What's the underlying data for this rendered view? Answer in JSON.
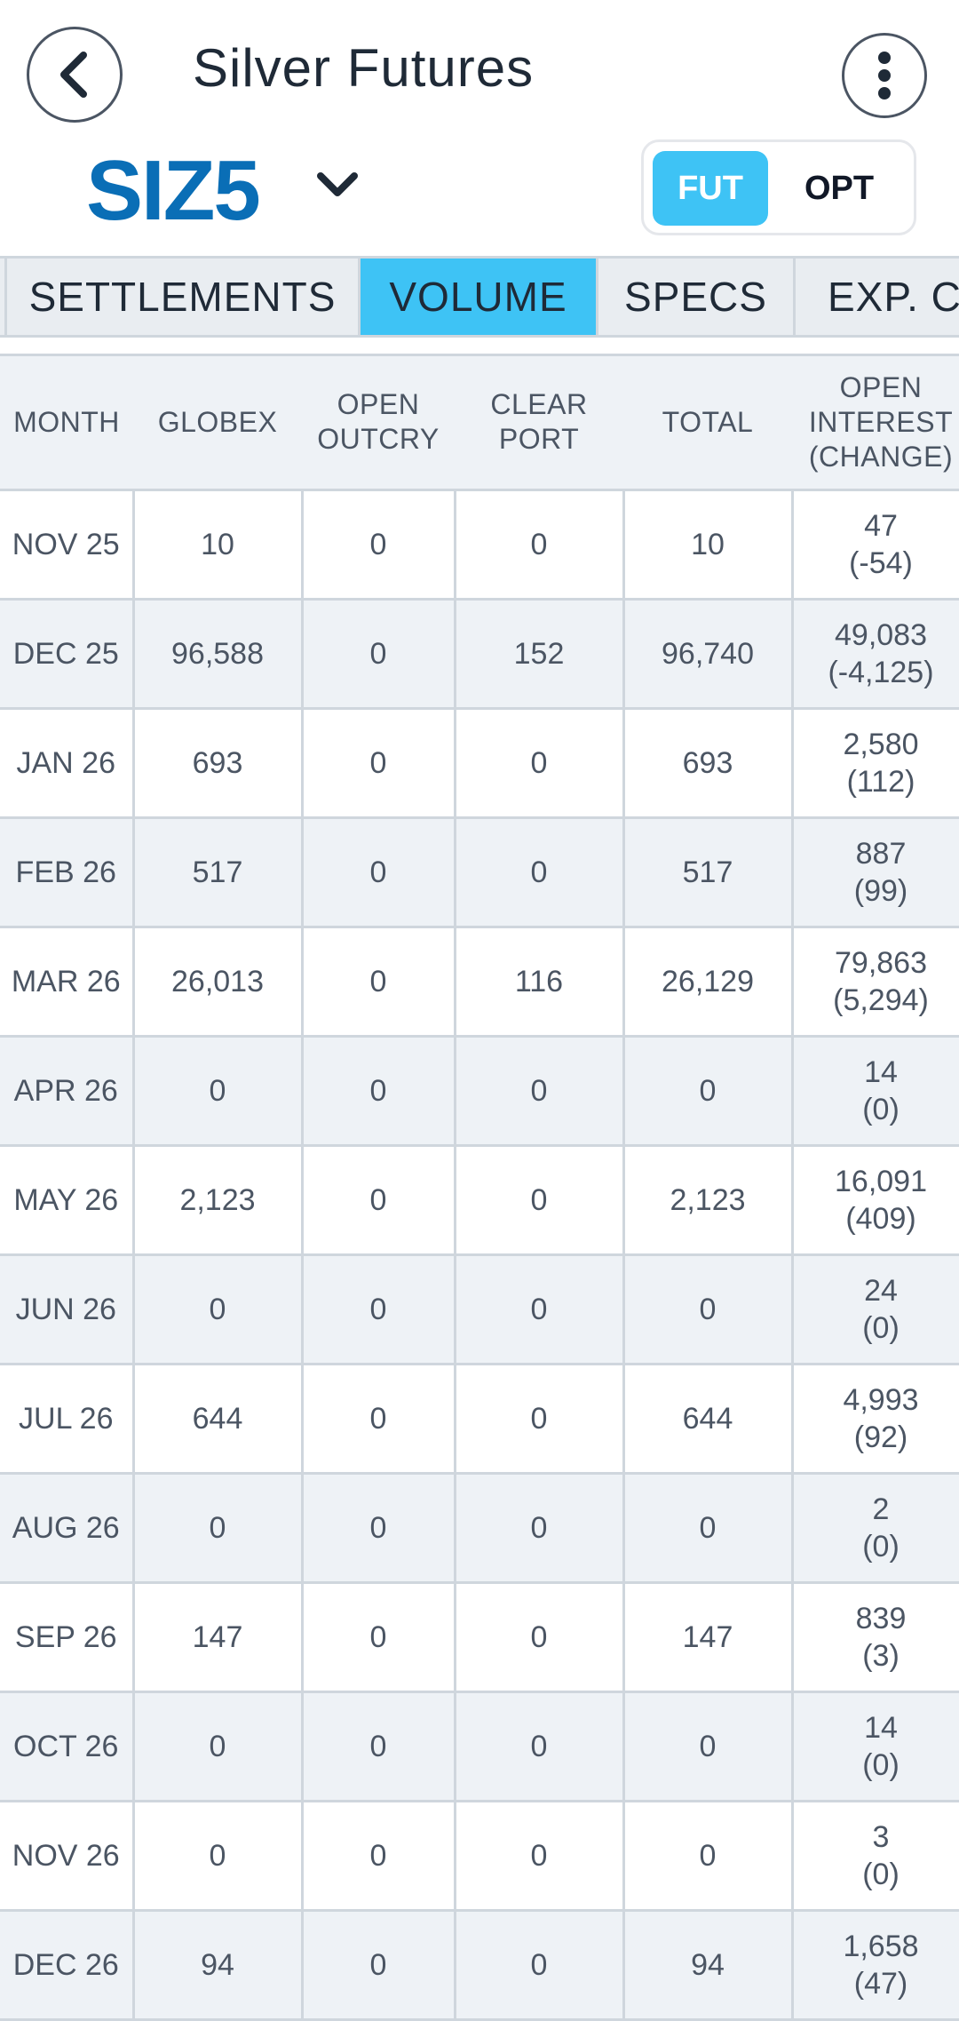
{
  "header": {
    "title": "Silver Futures",
    "symbol": "SIZ5",
    "segments": [
      {
        "label": "FUT",
        "active": true
      },
      {
        "label": "OPT",
        "active": false
      }
    ]
  },
  "tabs": [
    {
      "label": "SETTLEMENTS",
      "active": false
    },
    {
      "label": "VOLUME",
      "active": true
    },
    {
      "label": "SPECS",
      "active": false
    },
    {
      "label": "EXP. C",
      "active": false
    }
  ],
  "table": {
    "columns": [
      {
        "line1": "MONTH",
        "line2": "",
        "line3": ""
      },
      {
        "line1": "GLOBEX",
        "line2": "",
        "line3": ""
      },
      {
        "line1": "OPEN",
        "line2": "OUTCRY",
        "line3": ""
      },
      {
        "line1": "CLEAR",
        "line2": "PORT",
        "line3": ""
      },
      {
        "line1": "TOTAL",
        "line2": "",
        "line3": ""
      },
      {
        "line1": "OPEN",
        "line2": "INTEREST",
        "line3": "(CHANGE)"
      }
    ],
    "rows": [
      {
        "month": "NOV 25",
        "globex": "10",
        "open_outcry": "0",
        "clearport": "0",
        "total": "10",
        "oi": "47",
        "oi_change": "(-54)"
      },
      {
        "month": "DEC 25",
        "globex": "96,588",
        "open_outcry": "0",
        "clearport": "152",
        "total": "96,740",
        "oi": "49,083",
        "oi_change": "(-4,125)"
      },
      {
        "month": "JAN 26",
        "globex": "693",
        "open_outcry": "0",
        "clearport": "0",
        "total": "693",
        "oi": "2,580",
        "oi_change": "(112)"
      },
      {
        "month": "FEB 26",
        "globex": "517",
        "open_outcry": "0",
        "clearport": "0",
        "total": "517",
        "oi": "887",
        "oi_change": "(99)"
      },
      {
        "month": "MAR 26",
        "globex": "26,013",
        "open_outcry": "0",
        "clearport": "116",
        "total": "26,129",
        "oi": "79,863",
        "oi_change": "(5,294)"
      },
      {
        "month": "APR 26",
        "globex": "0",
        "open_outcry": "0",
        "clearport": "0",
        "total": "0",
        "oi": "14",
        "oi_change": "(0)"
      },
      {
        "month": "MAY 26",
        "globex": "2,123",
        "open_outcry": "0",
        "clearport": "0",
        "total": "2,123",
        "oi": "16,091",
        "oi_change": "(409)"
      },
      {
        "month": "JUN 26",
        "globex": "0",
        "open_outcry": "0",
        "clearport": "0",
        "total": "0",
        "oi": "24",
        "oi_change": "(0)"
      },
      {
        "month": "JUL 26",
        "globex": "644",
        "open_outcry": "0",
        "clearport": "0",
        "total": "644",
        "oi": "4,993",
        "oi_change": "(92)"
      },
      {
        "month": "AUG 26",
        "globex": "0",
        "open_outcry": "0",
        "clearport": "0",
        "total": "0",
        "oi": "2",
        "oi_change": "(0)"
      },
      {
        "month": "SEP 26",
        "globex": "147",
        "open_outcry": "0",
        "clearport": "0",
        "total": "147",
        "oi": "839",
        "oi_change": "(3)"
      },
      {
        "month": "OCT 26",
        "globex": "0",
        "open_outcry": "0",
        "clearport": "0",
        "total": "0",
        "oi": "14",
        "oi_change": "(0)"
      },
      {
        "month": "NOV 26",
        "globex": "0",
        "open_outcry": "0",
        "clearport": "0",
        "total": "0",
        "oi": "3",
        "oi_change": "(0)"
      },
      {
        "month": "DEC 26",
        "globex": "94",
        "open_outcry": "0",
        "clearport": "0",
        "total": "94",
        "oi": "1,658",
        "oi_change": "(47)"
      }
    ]
  },
  "icons": {
    "back": "chevron-left-icon",
    "more": "more-vertical-icon",
    "symbol_dropdown": "chevron-down-icon"
  },
  "colors": {
    "accent": "#3ec3f5",
    "symbol": "#0a6eb6",
    "row_alt": "#eef2f6",
    "grid": "#cfd6dd"
  }
}
